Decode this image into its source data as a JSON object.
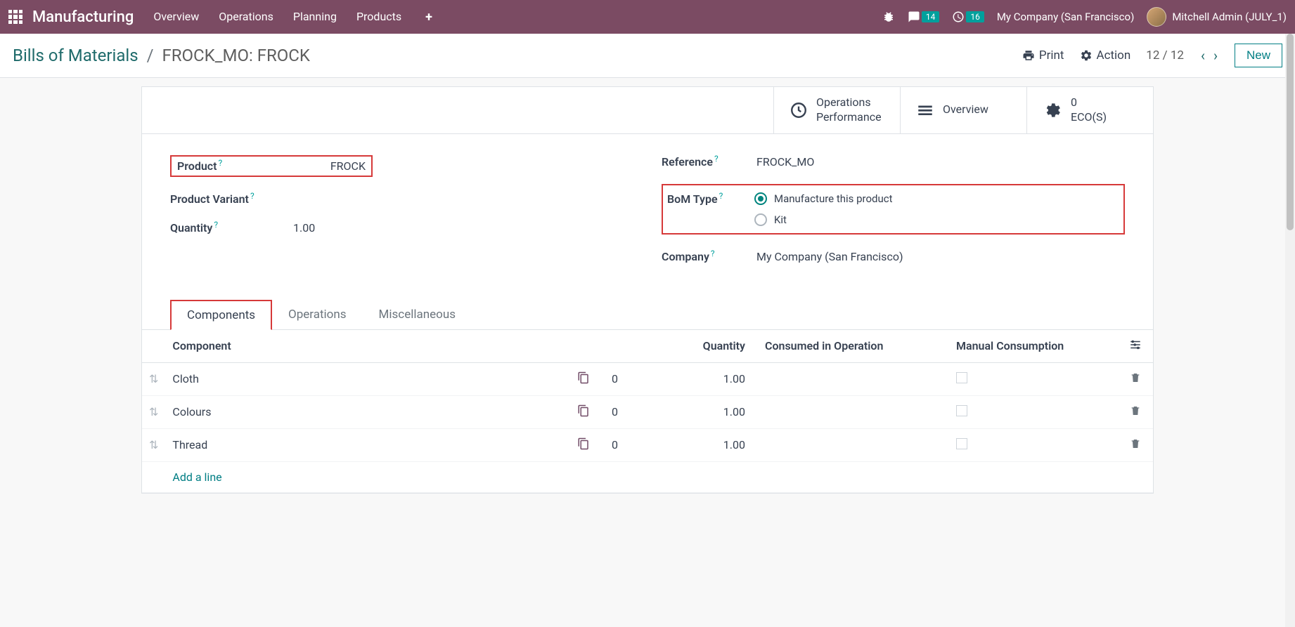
{
  "topnav": {
    "brand": "Manufacturing",
    "menu": [
      "Overview",
      "Operations",
      "Planning",
      "Products"
    ],
    "msg_count": "14",
    "activity_count": "16",
    "company": "My Company (San Francisco)",
    "user": "Mitchell Admin (JULY_1)"
  },
  "breadcrumb": {
    "root": "Bills of Materials",
    "current": "FROCK_MO: FROCK"
  },
  "controls": {
    "print": "Print",
    "action": "Action",
    "pager": "12 / 12",
    "new": "New"
  },
  "statbuttons": {
    "ops_perf_1": "Operations",
    "ops_perf_2": "Performance",
    "overview": "Overview",
    "ecos_count": "0",
    "ecos_label": "ECO(S)"
  },
  "form": {
    "product_label": "Product",
    "product_value": "FROCK",
    "variant_label": "Product Variant",
    "variant_value": "",
    "qty_label": "Quantity",
    "qty_value": "1.00",
    "ref_label": "Reference",
    "ref_value": "FROCK_MO",
    "bomtype_label": "BoM Type",
    "bomtype_opt1": "Manufacture this product",
    "bomtype_opt2": "Kit",
    "company_label": "Company",
    "company_value": "My Company (San Francisco)"
  },
  "tabs": {
    "components": "Components",
    "operations": "Operations",
    "misc": "Miscellaneous"
  },
  "table": {
    "headers": {
      "component": "Component",
      "quantity": "Quantity",
      "consumed": "Consumed in Operation",
      "manual": "Manual Consumption"
    },
    "rows": [
      {
        "name": "Cloth",
        "sub": "0",
        "qty": "1.00"
      },
      {
        "name": "Colours",
        "sub": "0",
        "qty": "1.00"
      },
      {
        "name": "Thread",
        "sub": "0",
        "qty": "1.00"
      }
    ],
    "add_line": "Add a line"
  }
}
